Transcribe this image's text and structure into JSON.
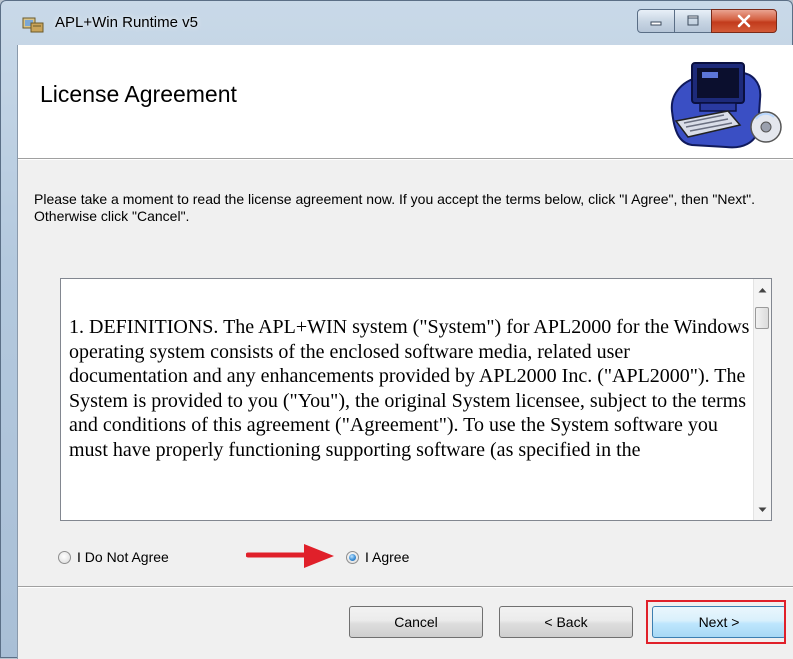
{
  "window": {
    "title": "APL+Win Runtime v5",
    "minimize_icon": "minimize-icon",
    "maximize_icon": "maximize-icon",
    "close_icon": "close-icon"
  },
  "header": {
    "title": "License Agreement",
    "art_icon": "computer-setup-icon"
  },
  "intro_text": "Please take a moment to read the license agreement now. If you accept the terms below, click \"I Agree\", then \"Next\". Otherwise click \"Cancel\".",
  "license": {
    "text": "1.  DEFINITIONS.  The APL+WIN system (\"System\") for APL2000 for the Windows operating system consists of the enclosed software media, related user documentation and any enhancements provided by APL2000 Inc. (\"APL2000\").  The System is provided to you (\"You\"), the original System licensee, subject to the terms and conditions of this agreement (\"Agreement\").  To use the System software you must have properly functioning supporting software (as specified in the"
  },
  "choices": {
    "disagree_label": "I Do Not Agree",
    "agree_label": "I Agree",
    "selected": "I Agree"
  },
  "buttons": {
    "cancel": "Cancel",
    "back": "< Back",
    "next": "Next >"
  },
  "colors": {
    "highlight": "#e0202a",
    "arrow": "#e0202a"
  }
}
